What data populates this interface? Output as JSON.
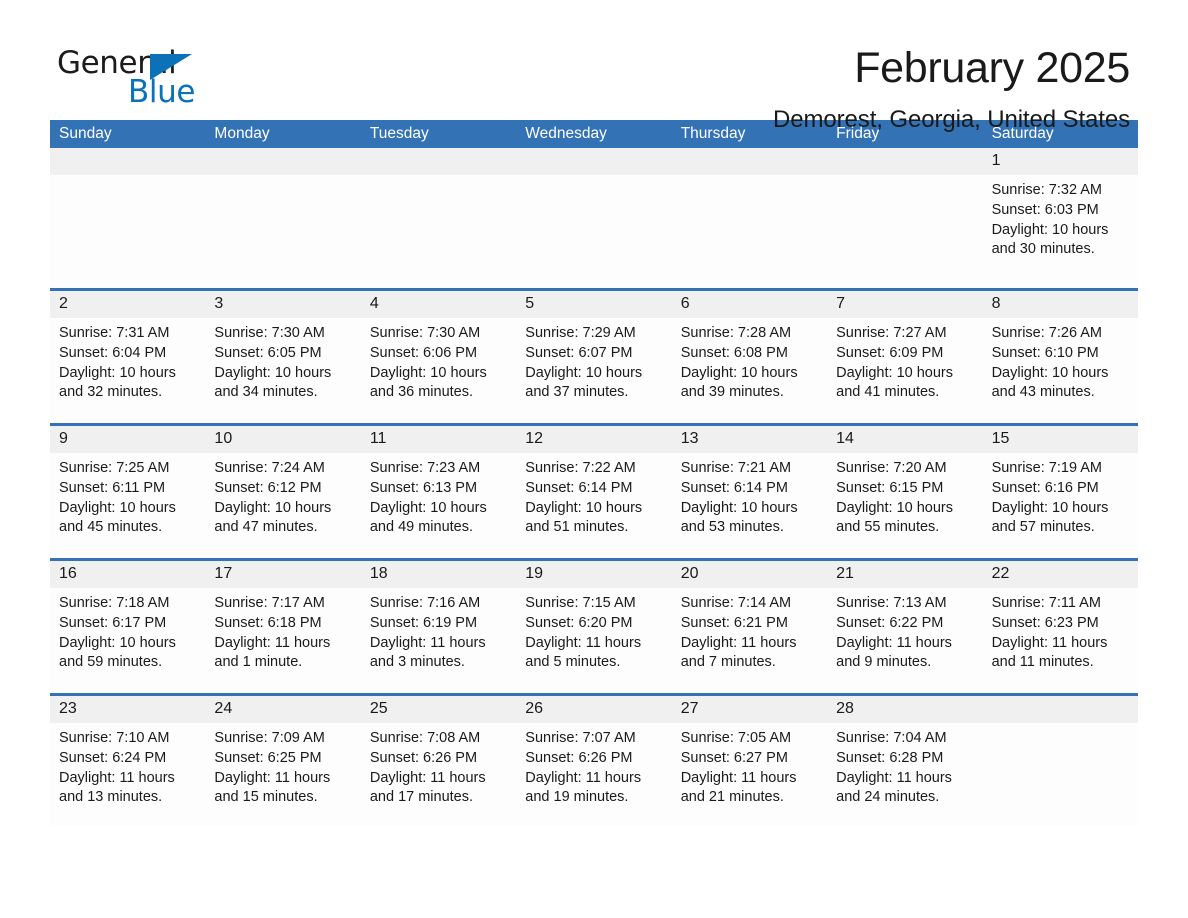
{
  "logo": {
    "word1": "General",
    "word2": "Blue",
    "triangle_color": "#0b72ba"
  },
  "header": {
    "title": "February 2025",
    "subtitle": "Demorest, Georgia, United States"
  },
  "theme": {
    "header_blue": "#3372b4",
    "row_divider_blue": "#3372b4",
    "daynum_band": "#f0f0f0",
    "cell_bg": "#fdfdfd"
  },
  "weekdays": [
    "Sunday",
    "Monday",
    "Tuesday",
    "Wednesday",
    "Thursday",
    "Friday",
    "Saturday"
  ],
  "weeks": [
    [
      {
        "day": "",
        "sunrise": "",
        "sunset": "",
        "daylight": ""
      },
      {
        "day": "",
        "sunrise": "",
        "sunset": "",
        "daylight": ""
      },
      {
        "day": "",
        "sunrise": "",
        "sunset": "",
        "daylight": ""
      },
      {
        "day": "",
        "sunrise": "",
        "sunset": "",
        "daylight": ""
      },
      {
        "day": "",
        "sunrise": "",
        "sunset": "",
        "daylight": ""
      },
      {
        "day": "",
        "sunrise": "",
        "sunset": "",
        "daylight": ""
      },
      {
        "day": "1",
        "sunrise": "Sunrise: 7:32 AM",
        "sunset": "Sunset: 6:03 PM",
        "daylight": "Daylight: 10 hours and 30 minutes."
      }
    ],
    [
      {
        "day": "2",
        "sunrise": "Sunrise: 7:31 AM",
        "sunset": "Sunset: 6:04 PM",
        "daylight": "Daylight: 10 hours and 32 minutes."
      },
      {
        "day": "3",
        "sunrise": "Sunrise: 7:30 AM",
        "sunset": "Sunset: 6:05 PM",
        "daylight": "Daylight: 10 hours and 34 minutes."
      },
      {
        "day": "4",
        "sunrise": "Sunrise: 7:30 AM",
        "sunset": "Sunset: 6:06 PM",
        "daylight": "Daylight: 10 hours and 36 minutes."
      },
      {
        "day": "5",
        "sunrise": "Sunrise: 7:29 AM",
        "sunset": "Sunset: 6:07 PM",
        "daylight": "Daylight: 10 hours and 37 minutes."
      },
      {
        "day": "6",
        "sunrise": "Sunrise: 7:28 AM",
        "sunset": "Sunset: 6:08 PM",
        "daylight": "Daylight: 10 hours and 39 minutes."
      },
      {
        "day": "7",
        "sunrise": "Sunrise: 7:27 AM",
        "sunset": "Sunset: 6:09 PM",
        "daylight": "Daylight: 10 hours and 41 minutes."
      },
      {
        "day": "8",
        "sunrise": "Sunrise: 7:26 AM",
        "sunset": "Sunset: 6:10 PM",
        "daylight": "Daylight: 10 hours and 43 minutes."
      }
    ],
    [
      {
        "day": "9",
        "sunrise": "Sunrise: 7:25 AM",
        "sunset": "Sunset: 6:11 PM",
        "daylight": "Daylight: 10 hours and 45 minutes."
      },
      {
        "day": "10",
        "sunrise": "Sunrise: 7:24 AM",
        "sunset": "Sunset: 6:12 PM",
        "daylight": "Daylight: 10 hours and 47 minutes."
      },
      {
        "day": "11",
        "sunrise": "Sunrise: 7:23 AM",
        "sunset": "Sunset: 6:13 PM",
        "daylight": "Daylight: 10 hours and 49 minutes."
      },
      {
        "day": "12",
        "sunrise": "Sunrise: 7:22 AM",
        "sunset": "Sunset: 6:14 PM",
        "daylight": "Daylight: 10 hours and 51 minutes."
      },
      {
        "day": "13",
        "sunrise": "Sunrise: 7:21 AM",
        "sunset": "Sunset: 6:14 PM",
        "daylight": "Daylight: 10 hours and 53 minutes."
      },
      {
        "day": "14",
        "sunrise": "Sunrise: 7:20 AM",
        "sunset": "Sunset: 6:15 PM",
        "daylight": "Daylight: 10 hours and 55 minutes."
      },
      {
        "day": "15",
        "sunrise": "Sunrise: 7:19 AM",
        "sunset": "Sunset: 6:16 PM",
        "daylight": "Daylight: 10 hours and 57 minutes."
      }
    ],
    [
      {
        "day": "16",
        "sunrise": "Sunrise: 7:18 AM",
        "sunset": "Sunset: 6:17 PM",
        "daylight": "Daylight: 10 hours and 59 minutes."
      },
      {
        "day": "17",
        "sunrise": "Sunrise: 7:17 AM",
        "sunset": "Sunset: 6:18 PM",
        "daylight": "Daylight: 11 hours and 1 minute."
      },
      {
        "day": "18",
        "sunrise": "Sunrise: 7:16 AM",
        "sunset": "Sunset: 6:19 PM",
        "daylight": "Daylight: 11 hours and 3 minutes."
      },
      {
        "day": "19",
        "sunrise": "Sunrise: 7:15 AM",
        "sunset": "Sunset: 6:20 PM",
        "daylight": "Daylight: 11 hours and 5 minutes."
      },
      {
        "day": "20",
        "sunrise": "Sunrise: 7:14 AM",
        "sunset": "Sunset: 6:21 PM",
        "daylight": "Daylight: 11 hours and 7 minutes."
      },
      {
        "day": "21",
        "sunrise": "Sunrise: 7:13 AM",
        "sunset": "Sunset: 6:22 PM",
        "daylight": "Daylight: 11 hours and 9 minutes."
      },
      {
        "day": "22",
        "sunrise": "Sunrise: 7:11 AM",
        "sunset": "Sunset: 6:23 PM",
        "daylight": "Daylight: 11 hours and 11 minutes."
      }
    ],
    [
      {
        "day": "23",
        "sunrise": "Sunrise: 7:10 AM",
        "sunset": "Sunset: 6:24 PM",
        "daylight": "Daylight: 11 hours and 13 minutes."
      },
      {
        "day": "24",
        "sunrise": "Sunrise: 7:09 AM",
        "sunset": "Sunset: 6:25 PM",
        "daylight": "Daylight: 11 hours and 15 minutes."
      },
      {
        "day": "25",
        "sunrise": "Sunrise: 7:08 AM",
        "sunset": "Sunset: 6:26 PM",
        "daylight": "Daylight: 11 hours and 17 minutes."
      },
      {
        "day": "26",
        "sunrise": "Sunrise: 7:07 AM",
        "sunset": "Sunset: 6:26 PM",
        "daylight": "Daylight: 11 hours and 19 minutes."
      },
      {
        "day": "27",
        "sunrise": "Sunrise: 7:05 AM",
        "sunset": "Sunset: 6:27 PM",
        "daylight": "Daylight: 11 hours and 21 minutes."
      },
      {
        "day": "28",
        "sunrise": "Sunrise: 7:04 AM",
        "sunset": "Sunset: 6:28 PM",
        "daylight": "Daylight: 11 hours and 24 minutes."
      },
      {
        "day": "",
        "sunrise": "",
        "sunset": "",
        "daylight": ""
      }
    ]
  ]
}
